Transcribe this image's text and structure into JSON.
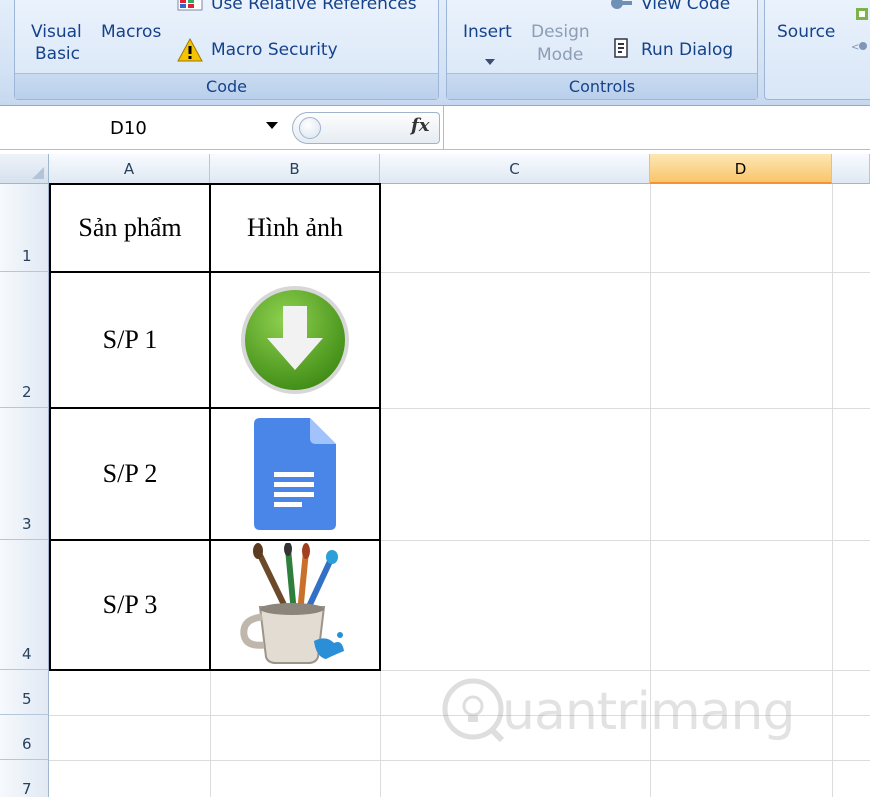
{
  "ribbon": {
    "code_group": {
      "visual_basic": "Visual Basic",
      "visual_basic_line1": "Visual",
      "visual_basic_line2": "Basic",
      "macros": "Macros",
      "use_relative_references": "Use Relative References",
      "macro_security": "Macro Security",
      "label": "Code"
    },
    "controls_group": {
      "insert": "Insert",
      "design_mode_line1": "Design",
      "design_mode_line2": "Mode",
      "view_code": "View Code",
      "run_dialog": "Run Dialog",
      "label": "Controls"
    },
    "xml_group": {
      "source": "Source"
    }
  },
  "formula_bar": {
    "name_box": "D10",
    "fx_label": "fx",
    "formula": ""
  },
  "grid": {
    "columns": [
      "A",
      "B",
      "C",
      "D"
    ],
    "active_column": "D",
    "rows": [
      "1",
      "2",
      "3",
      "4",
      "5",
      "6",
      "7"
    ],
    "cells": {
      "A1": "Sản phẩm",
      "B1": "Hình ảnh",
      "A2": "S/P 1",
      "A3": "S/P 2",
      "A4": "S/P 3"
    },
    "images": {
      "B2": "download-arrow-icon",
      "B3": "google-docs-icon",
      "B4": "paint-brushes-cup-icon"
    }
  },
  "watermark": {
    "text": "uantrimang"
  },
  "colors": {
    "accent_header": "#f9c56b",
    "ribbon_text": "#15428b",
    "download_green": "#5aa821",
    "docs_blue": "#4a86e8"
  }
}
